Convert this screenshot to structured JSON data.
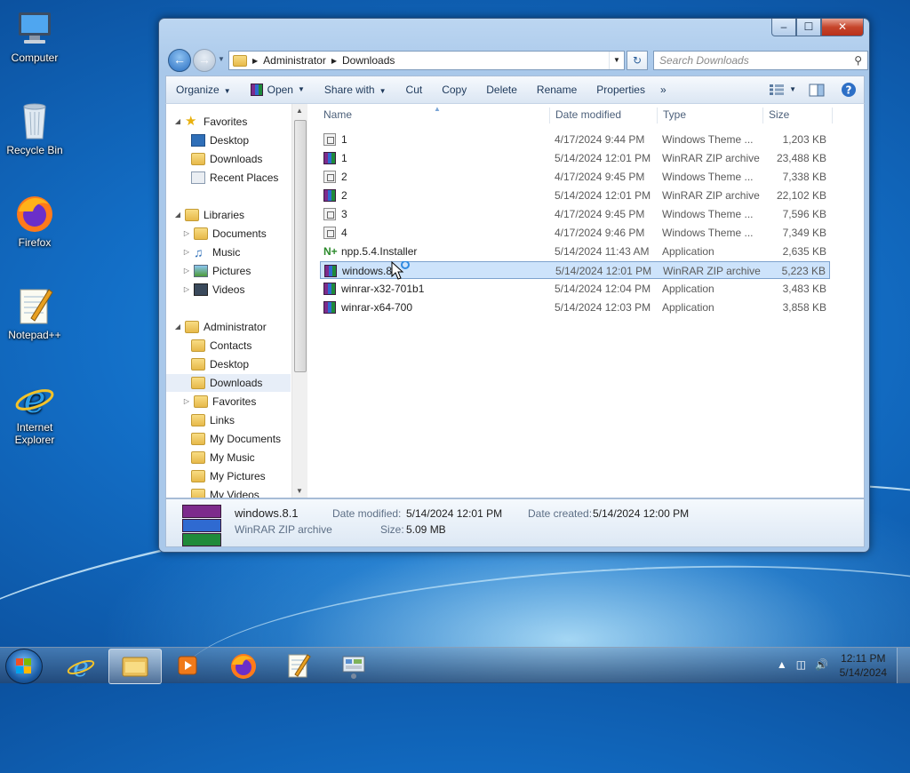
{
  "desktop": {
    "icons": [
      {
        "label": "Computer",
        "icon": "computer-icon"
      },
      {
        "label": "Recycle Bin",
        "icon": "recycle-bin-icon"
      },
      {
        "label": "Firefox",
        "icon": "firefox-icon"
      },
      {
        "label": "Notepad++",
        "icon": "notepad-plus-plus-icon"
      },
      {
        "label": "Internet Explorer",
        "icon": "internet-explorer-icon"
      }
    ]
  },
  "window": {
    "buttons": {
      "minimize": "‒",
      "maximize": "☐",
      "close": "✕"
    },
    "address": {
      "crumbs": [
        "Administrator",
        "Downloads"
      ]
    },
    "search": {
      "placeholder": "Search Downloads"
    }
  },
  "toolbar": {
    "organize": "Organize",
    "open": "Open",
    "share_with": "Share with",
    "cut": "Cut",
    "copy": "Copy",
    "delete": "Delete",
    "rename": "Rename",
    "properties": "Properties",
    "more": "»"
  },
  "nav": {
    "favorites": "Favorites",
    "fav_desktop": "Desktop",
    "fav_downloads": "Downloads",
    "fav_recent": "Recent Places",
    "libraries": "Libraries",
    "lib_documents": "Documents",
    "lib_music": "Music",
    "lib_pictures": "Pictures",
    "lib_videos": "Videos",
    "administrator": "Administrator",
    "adm_contacts": "Contacts",
    "adm_desktop": "Desktop",
    "adm_downloads": "Downloads",
    "adm_favorites": "Favorites",
    "adm_links": "Links",
    "adm_mydocuments": "My Documents",
    "adm_mymusic": "My Music",
    "adm_mypictures": "My Pictures",
    "adm_myvideos": "My Videos"
  },
  "columns": {
    "name": "Name",
    "date": "Date modified",
    "type": "Type",
    "size": "Size"
  },
  "files": [
    {
      "name": "1",
      "date": "4/17/2024 9:44 PM",
      "type": "Windows Theme ...",
      "size": "1,203 KB",
      "icon": "theme"
    },
    {
      "name": "1",
      "date": "5/14/2024 12:01 PM",
      "type": "WinRAR ZIP archive",
      "size": "23,488 KB",
      "icon": "rar"
    },
    {
      "name": "2",
      "date": "4/17/2024 9:45 PM",
      "type": "Windows Theme ...",
      "size": "7,338 KB",
      "icon": "theme"
    },
    {
      "name": "2",
      "date": "5/14/2024 12:01 PM",
      "type": "WinRAR ZIP archive",
      "size": "22,102 KB",
      "icon": "rar"
    },
    {
      "name": "3",
      "date": "4/17/2024 9:45 PM",
      "type": "Windows Theme ...",
      "size": "7,596 KB",
      "icon": "theme"
    },
    {
      "name": "4",
      "date": "4/17/2024 9:46 PM",
      "type": "Windows Theme ...",
      "size": "7,349 KB",
      "icon": "theme"
    },
    {
      "name": "npp.5.4.Installer",
      "date": "5/14/2024 11:43 AM",
      "type": "Application",
      "size": "2,635 KB",
      "icon": "npp"
    },
    {
      "name": "windows.8",
      "date": "5/14/2024 12:01 PM",
      "type": "WinRAR ZIP archive",
      "size": "5,223 KB",
      "icon": "rar",
      "selected": true
    },
    {
      "name": "winrar-x32-701b1",
      "date": "5/14/2024 12:04 PM",
      "type": "Application",
      "size": "3,483 KB",
      "icon": "rar"
    },
    {
      "name": "winrar-x64-700",
      "date": "5/14/2024 12:03 PM",
      "type": "Application",
      "size": "3,858 KB",
      "icon": "rar"
    }
  ],
  "details": {
    "name": "windows.8.1",
    "type": "WinRAR ZIP archive",
    "date_modified_label": "Date modified:",
    "date_modified": "5/14/2024 12:01 PM",
    "date_created_label": "Date created:",
    "date_created": "5/14/2024 12:00 PM",
    "size_label": "Size:",
    "size": "5.09 MB"
  },
  "taskbar": {
    "time": "12:11 PM",
    "date": "5/14/2024"
  }
}
